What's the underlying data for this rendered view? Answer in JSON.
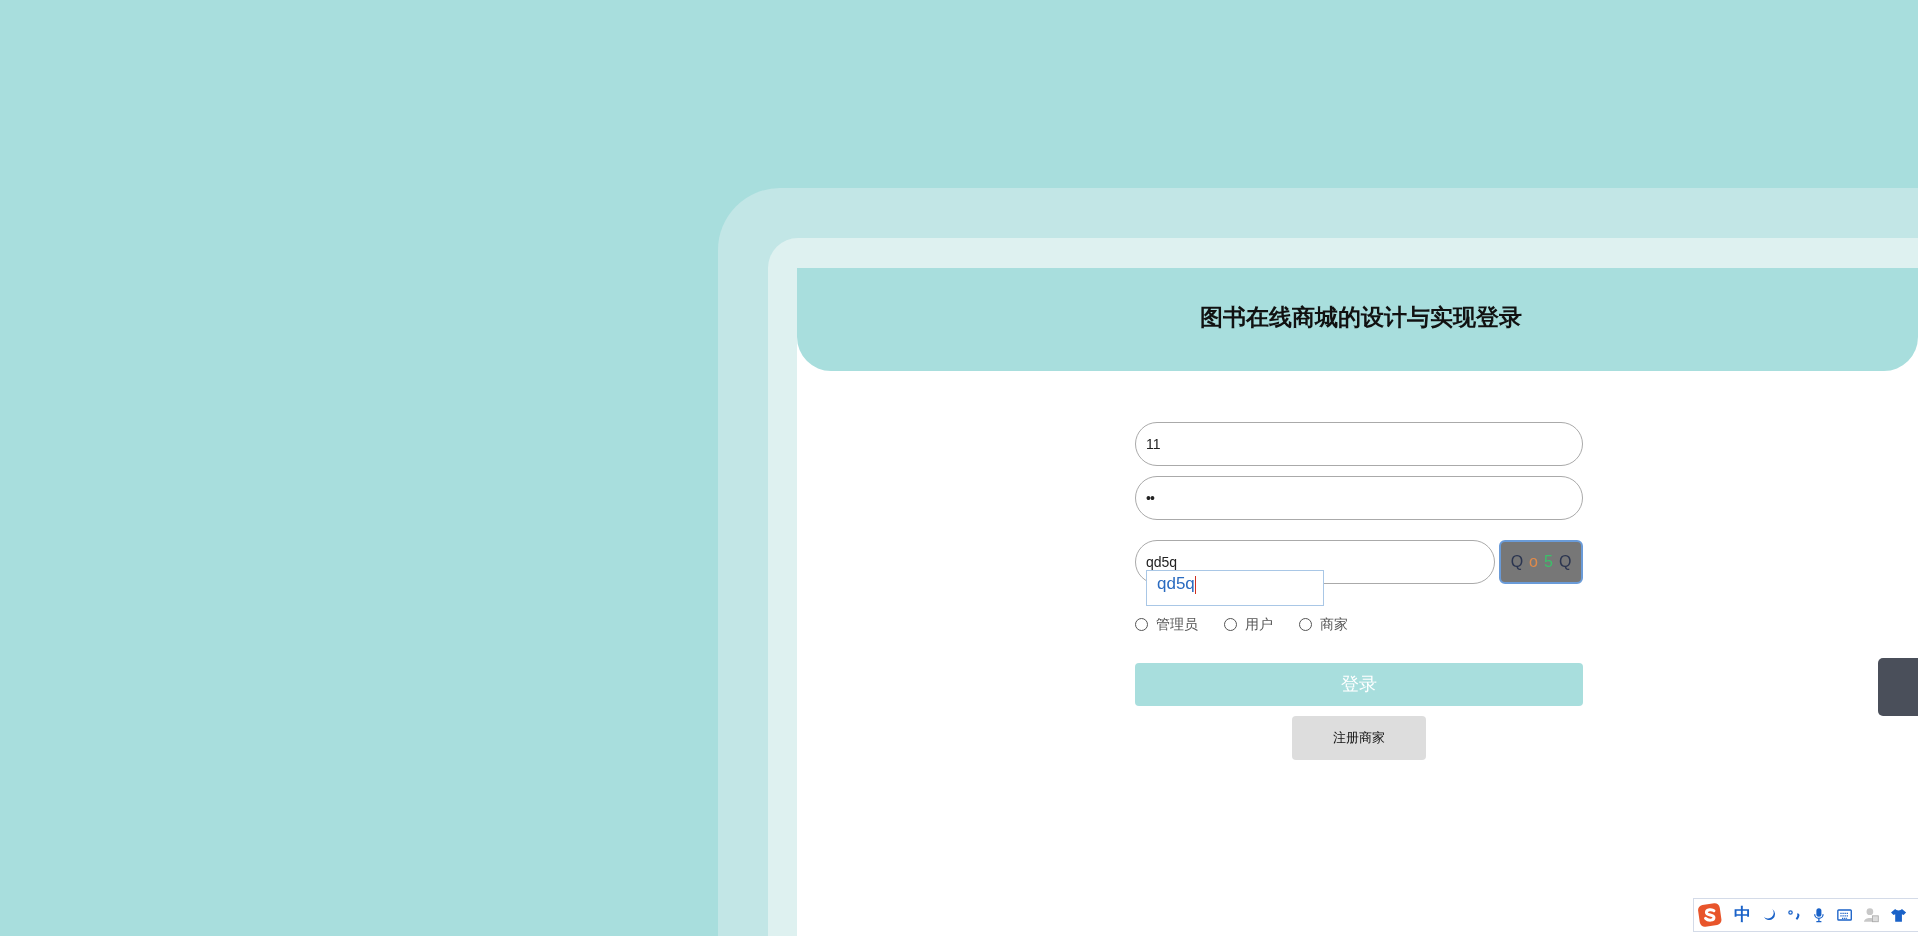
{
  "title": "图书在线商城的设计与实现登录",
  "fields": [
    {
      "kind": "text",
      "value": "11"
    },
    {
      "kind": "password",
      "value": "••"
    }
  ],
  "captcha": {
    "value": "qd5q",
    "chars": [
      {
        "char": "Q",
        "color": "#2b3550"
      },
      {
        "char": "o",
        "color": "#e08a4a"
      },
      {
        "char": "5",
        "color": "#3cc06a"
      },
      {
        "char": "Q",
        "color": "#2b3550"
      }
    ]
  },
  "autocomplete": {
    "suggestion": "qd5q"
  },
  "roles": [
    {
      "label": "管理员",
      "selected": false
    },
    {
      "label": "用户",
      "selected": false
    },
    {
      "label": "商家",
      "selected": false
    }
  ],
  "login_button": "登录",
  "register_button": "注册商家",
  "ime_toolbar": {
    "mode": "中"
  }
}
